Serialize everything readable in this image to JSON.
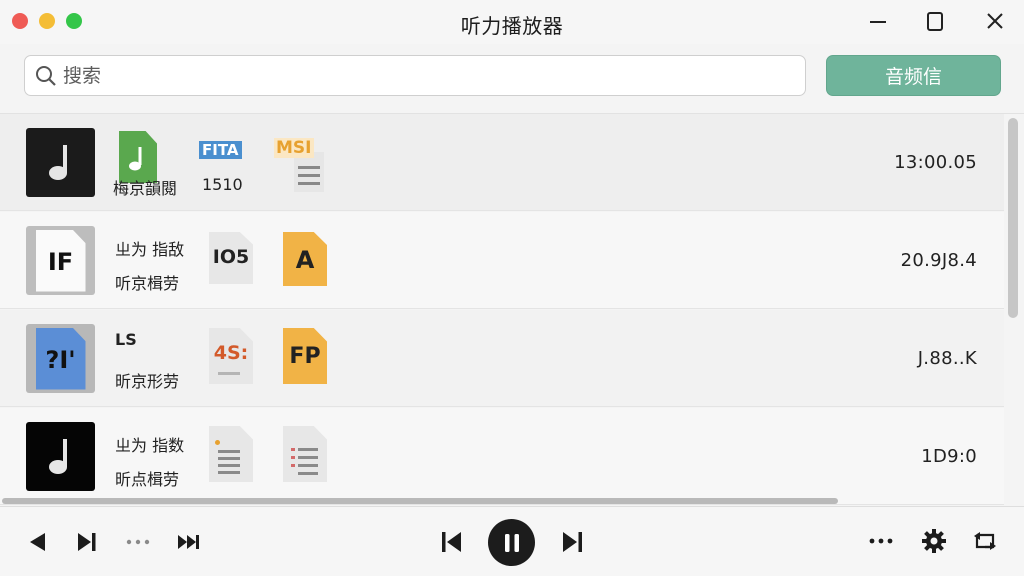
{
  "window": {
    "title": "听力播放器"
  },
  "search": {
    "placeholder": "搜索"
  },
  "toolbar": {
    "primary_label": "音频信"
  },
  "rows": [
    {
      "thumb_style": "note-dark",
      "icon1": {
        "type": "green-note"
      },
      "icon1_caption": "梅京韻閱",
      "icon2": {
        "label": "FITA"
      },
      "icon2_caption": "1510",
      "icon3": {
        "label": "MSI"
      },
      "time": "13:00.05"
    },
    {
      "thumb_style": "doc-gray",
      "thumb_label": "IF",
      "col1_title": "ㄓ为 指敌",
      "col1_sub": "听京楫劳",
      "icon2": {
        "label": "IO5"
      },
      "icon3": {
        "label": "A"
      },
      "time": "20.9J8.4"
    },
    {
      "thumb_style": "doc-blue",
      "thumb_label": "?I'",
      "col1_title": "LS",
      "col1_sub": "昕京形劳",
      "icon2": {
        "label": "4S:"
      },
      "icon3": {
        "label": "FP"
      },
      "time": "J.88..K"
    },
    {
      "thumb_style": "note-black",
      "col1_title": "ㄓ为 指数",
      "col1_sub": "昕点楫劳",
      "icon2": {
        "label": ""
      },
      "icon3": {
        "label": ""
      },
      "time": "1D9:0"
    }
  ],
  "transport": {
    "icons": [
      "play-back-icon",
      "skip-icon",
      "dots-icon",
      "fast-forward-icon",
      "previous-icon",
      "pause-icon",
      "next-icon",
      "more-icon",
      "gear-icon",
      "repeat-icon"
    ]
  }
}
